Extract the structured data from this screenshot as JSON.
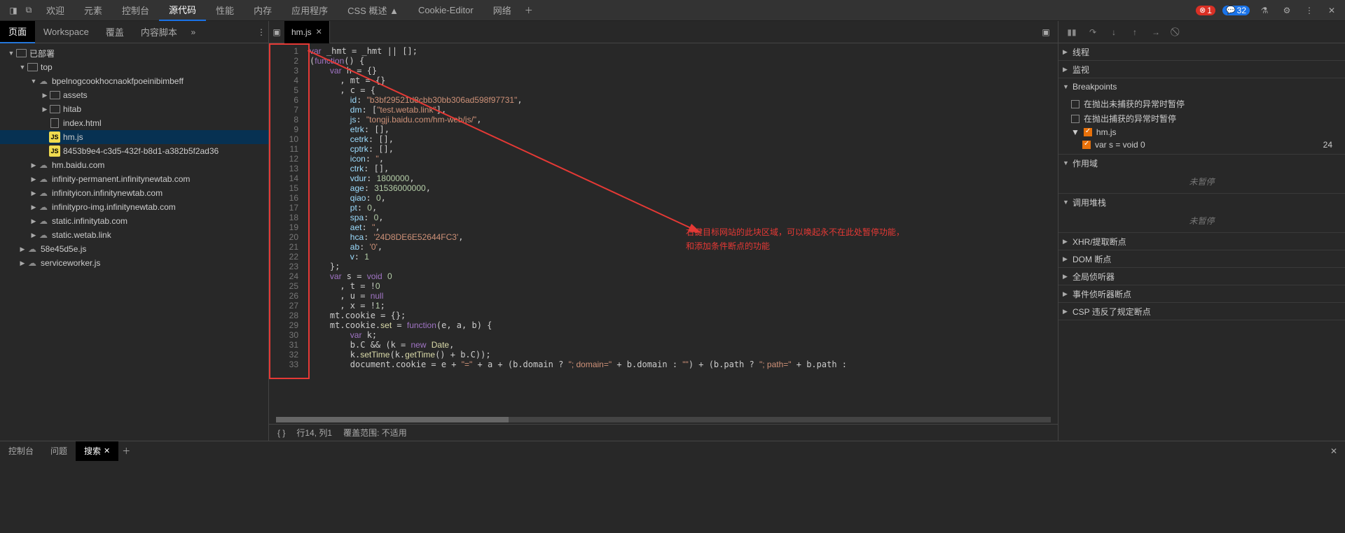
{
  "toolbar": {
    "tabs": [
      "欢迎",
      "元素",
      "控制台",
      "源代码",
      "性能",
      "内存",
      "应用程序",
      "CSS 概述 ▲",
      "Cookie-Editor",
      "网络"
    ],
    "active": 3,
    "errors": "1",
    "messages": "32"
  },
  "sidebar": {
    "tabs": [
      "页面",
      "Workspace",
      "覆盖",
      "内容脚本"
    ],
    "active": 0,
    "tree": [
      {
        "depth": 0,
        "arrow": "▼",
        "icon": "folder",
        "label": "已部署"
      },
      {
        "depth": 1,
        "arrow": "▼",
        "icon": "folder",
        "label": "top"
      },
      {
        "depth": 2,
        "arrow": "▼",
        "icon": "cloud",
        "label": "bpelnogcookhocnaokfpoeinibimbeff"
      },
      {
        "depth": 3,
        "arrow": "▶",
        "icon": "folder",
        "label": "assets"
      },
      {
        "depth": 3,
        "arrow": "▶",
        "icon": "folder",
        "label": "hitab"
      },
      {
        "depth": 3,
        "arrow": "",
        "icon": "file",
        "label": "index.html"
      },
      {
        "depth": 3,
        "arrow": "",
        "icon": "js",
        "label": "hm.js",
        "selected": true
      },
      {
        "depth": 3,
        "arrow": "",
        "icon": "js",
        "label": "8453b9e4-c3d5-432f-b8d1-a382b5f2ad36"
      },
      {
        "depth": 2,
        "arrow": "▶",
        "icon": "cloud",
        "label": "hm.baidu.com"
      },
      {
        "depth": 2,
        "arrow": "▶",
        "icon": "cloud",
        "label": "infinity-permanent.infinitynewtab.com"
      },
      {
        "depth": 2,
        "arrow": "▶",
        "icon": "cloud",
        "label": "infinityicon.infinitynewtab.com"
      },
      {
        "depth": 2,
        "arrow": "▶",
        "icon": "cloud",
        "label": "infinitypro-img.infinitynewtab.com"
      },
      {
        "depth": 2,
        "arrow": "▶",
        "icon": "cloud",
        "label": "static.infinitytab.com"
      },
      {
        "depth": 2,
        "arrow": "▶",
        "icon": "cloud",
        "label": "static.wetab.link"
      },
      {
        "depth": 1,
        "arrow": "▶",
        "icon": "cloud",
        "label": "58e45d5e.js"
      },
      {
        "depth": 1,
        "arrow": "▶",
        "icon": "cloud",
        "label": "serviceworker.js"
      }
    ]
  },
  "editor": {
    "tab": "hm.js",
    "lines": 33,
    "breakpoint_line": 24,
    "status_braces": "{ }",
    "status_pos": "行14, 列1",
    "status_cov": "覆盖范围: 不适用"
  },
  "annotation": {
    "line1": "右键目标网站的此块区域，可以唤起永不在此处暂停功能，",
    "line2": "和添加条件断点的功能"
  },
  "debugger": {
    "sections": {
      "threads": "线程",
      "watch": "监视",
      "breakpoints": "Breakpoints",
      "scope": "作用域",
      "callstack": "调用堆栈",
      "xhr": "XHR/提取断点",
      "dom": "DOM 断点",
      "global": "全局侦听器",
      "event": "事件侦听器断点",
      "csp": "CSP 违反了规定断点"
    },
    "bp_opts": {
      "uncaught": "在抛出未捕获的异常时暂停",
      "caught": "在抛出捕获的异常时暂停"
    },
    "bp_file": "hm.js",
    "bp_line": "var s = void 0",
    "bp_num": "24",
    "not_paused": "未暂停"
  },
  "console": {
    "tabs": [
      "控制台",
      "问题",
      "搜索"
    ],
    "active": 2
  }
}
